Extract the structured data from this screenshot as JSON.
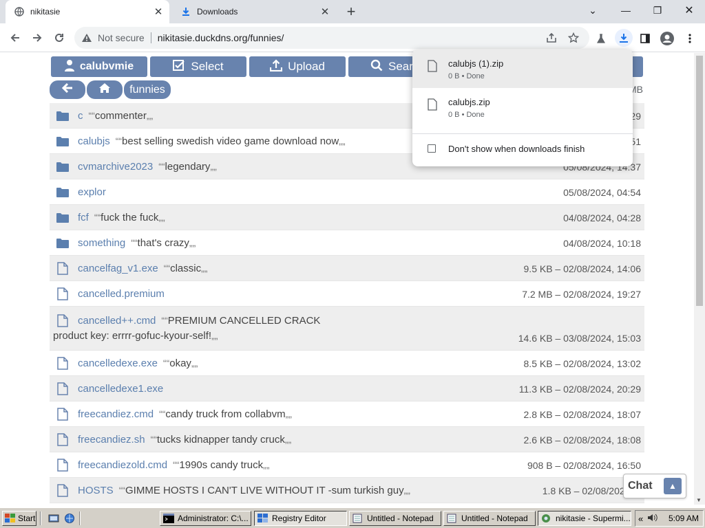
{
  "browser": {
    "tabs": [
      {
        "title": "nikitasie",
        "active": true
      },
      {
        "title": "Downloads",
        "active": false
      }
    ],
    "new_tab": "+",
    "window_controls": {
      "collapse": "⌄",
      "minimize": "—",
      "restore": "❐",
      "close": "✕"
    },
    "address": {
      "security": "Not secure",
      "url": "nikitasie.duckdns.org/funnies/"
    }
  },
  "page": {
    "buttons": {
      "user": "calubvmie",
      "select": "Select",
      "upload": "Upload",
      "search": "Search"
    },
    "breadcrumbs": {
      "back": "←",
      "home": "⌂",
      "folder": "funnies"
    },
    "total_size": "MB",
    "rows": [
      {
        "type": "folder",
        "name": "c",
        "desc": "commenter",
        "meta": "29"
      },
      {
        "type": "folder",
        "name": "calubjs",
        "desc": "best selling swedish video game download now",
        "meta": "51"
      },
      {
        "type": "folder",
        "name": "cvmarchive2023",
        "desc": "legendary",
        "meta": "05/08/2024, 14:37"
      },
      {
        "type": "folder",
        "name": "explor",
        "desc": "",
        "meta": "05/08/2024, 04:54"
      },
      {
        "type": "folder",
        "name": "fcf",
        "desc": "fuck the fuck",
        "meta": "04/08/2024, 04:28"
      },
      {
        "type": "folder",
        "name": "something",
        "desc": "that's crazy",
        "meta": "04/08/2024, 10:18"
      },
      {
        "type": "file",
        "name": "cancelfag_v1.exe",
        "desc": "classic",
        "meta": "9.5 KB – 02/08/2024, 14:06"
      },
      {
        "type": "file",
        "name": "cancelled.premium",
        "desc": "",
        "meta": "7.2 MB – 02/08/2024, 19:27"
      },
      {
        "type": "file",
        "name": "cancelled++.cmd",
        "desc": "PREMIUM CANCELLED CRACK",
        "desc2": "product key: errrr-gofuc-kyour-self!",
        "meta": "14.6 KB – 03/08/2024, 15:03"
      },
      {
        "type": "file",
        "name": "cancelledexe.exe",
        "desc": "okay",
        "meta": "8.5 KB – 02/08/2024, 13:02"
      },
      {
        "type": "file",
        "name": "cancelledexe1.exe",
        "desc": "",
        "meta": "11.3 KB – 02/08/2024, 20:29"
      },
      {
        "type": "file",
        "name": "freecandiez.cmd",
        "desc": "candy truck from collabvm",
        "meta": "2.8 KB – 02/08/2024, 18:07"
      },
      {
        "type": "file",
        "name": "freecandiez.sh",
        "desc": "tucks kidnapper tandy cruck",
        "meta": "2.6 KB – 02/08/2024, 18:08"
      },
      {
        "type": "file",
        "name": "freecandiezold.cmd",
        "desc": "1990s candy truck",
        "meta": "908 B – 02/08/2024, 16:50"
      },
      {
        "type": "file",
        "name": "HOSTS",
        "desc": "GIMME HOSTS I CAN'T LIVE WITHOUT IT -sum turkish guy",
        "meta": "1.8 KB – 02/08/2024, 1"
      }
    ],
    "chat": {
      "label": "Chat",
      "toggle": "▲"
    }
  },
  "downloads_bubble": {
    "items": [
      {
        "name": "calubjs (1).zip",
        "status": "0 B • Done"
      },
      {
        "name": "calubjs.zip",
        "status": "0 B • Done"
      }
    ],
    "option": "Don't show when downloads finish"
  },
  "taskbar": {
    "start": "Start",
    "buttons": [
      {
        "label": "Administrator: C:\\..."
      },
      {
        "label": "Registry Editor"
      },
      {
        "label": "Untitled - Notepad"
      },
      {
        "label": "Untitled - Notepad"
      },
      {
        "label": "nikitasie - Supermi..."
      }
    ],
    "tray_chevron": "«",
    "clock": "5:09 AM"
  },
  "colors": {
    "accent": "#6883ae",
    "link": "#5b7fae",
    "chrome_bg": "#dee1e6",
    "taskbar": "#d4d0c8"
  }
}
